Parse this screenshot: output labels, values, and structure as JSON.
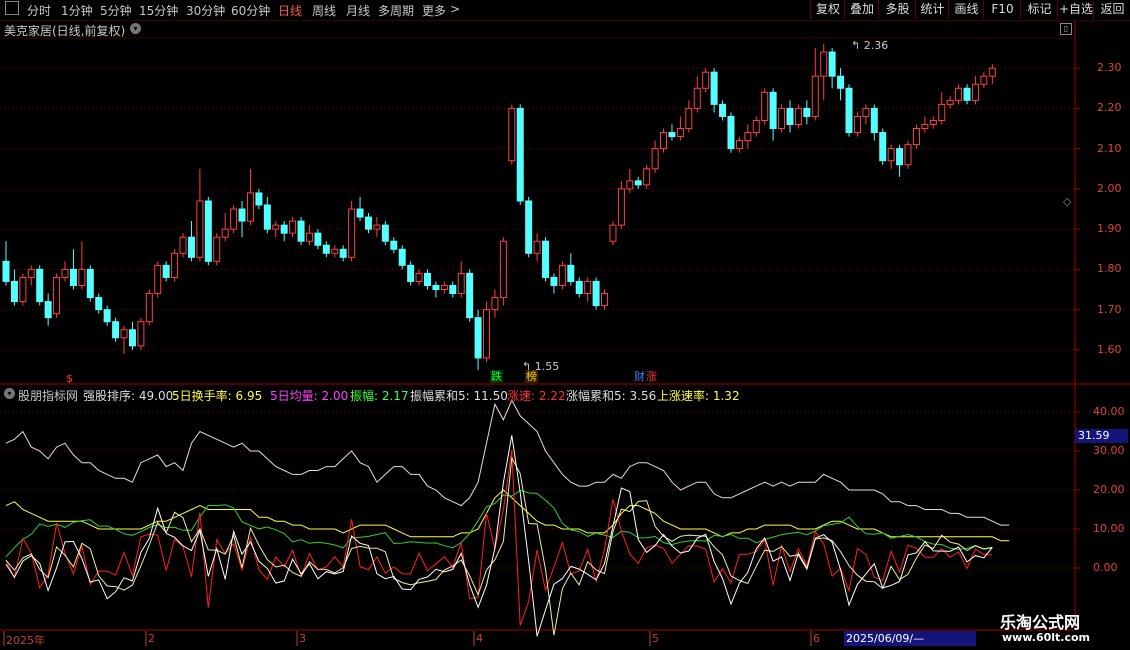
{
  "toolbar": {
    "periods": [
      "分时",
      "1分钟",
      "5分钟",
      "15分钟",
      "30分钟",
      "60分钟",
      "日线",
      "周线",
      "月线",
      "多周期",
      "更多"
    ],
    "active": "日线",
    "more_arrow": ">",
    "buttons": [
      "复权",
      "叠加",
      "多股",
      "统计",
      "画线",
      "F10",
      "标记",
      "+自选",
      "返回"
    ]
  },
  "chart_title": "美克家居(日线,前复权)",
  "price_axis": {
    "labels": [
      "2.30",
      "2.20",
      "2.10",
      "2.00",
      "1.90",
      "1.80",
      "1.70",
      "1.60"
    ],
    "values": [
      2.3,
      2.2,
      2.1,
      2.0,
      1.9,
      1.8,
      1.7,
      1.6
    ]
  },
  "annotations": {
    "high": "2.36",
    "low": "1.55"
  },
  "badges": [
    {
      "text": "$",
      "color": "#ff3030"
    },
    {
      "text": "跌",
      "color": "#00ff40"
    },
    {
      "text": "榜",
      "color": "#ffcc00"
    },
    {
      "text": "财",
      "color": "#4080ff"
    },
    {
      "text": "涨",
      "color": "#ff3030"
    }
  ],
  "indicator": {
    "name": "股朋指标网",
    "items": [
      {
        "label": "强股排序:",
        "value": "49.00",
        "color": "#dddddd"
      },
      {
        "label": "5日换手率:",
        "value": "6.95",
        "color": "#ffff40"
      },
      {
        "label": "5日均量:",
        "value": "2.00",
        "color": "#ff40ff"
      },
      {
        "label": "振幅:",
        "value": "2.17",
        "color": "#40ff40"
      },
      {
        "label": "振幅累和5:",
        "value": "11.50",
        "color": "#dddddd"
      },
      {
        "label": "涨速:",
        "value": "2.22",
        "color": "#ff3030"
      },
      {
        "label": "涨幅累和5:",
        "value": "3.56",
        "color": "#dddddd"
      },
      {
        "label": "上涨速率:",
        "value": "1.32",
        "color": "#ffff40"
      }
    ],
    "axis_labels": [
      "40.00",
      "30.00",
      "20.00",
      "10.00",
      "0.00"
    ],
    "current_value": "31.59"
  },
  "dates": [
    "2025年",
    "2",
    "3",
    "4",
    "5",
    "6"
  ],
  "date_cursor": "2025/06/09/—",
  "watermark": {
    "line1": "乐淘公式网",
    "line2": "www.60lt.com"
  },
  "colors": {
    "up": "#ff4040",
    "down": "#54ffff",
    "grid": "#7a0000",
    "white_line": "#e0e0e0",
    "yellow_line": "#ffff40",
    "green_line": "#30d030",
    "red_line": "#ff2020"
  },
  "chart_data": {
    "type": "candlestick",
    "title": "美克家居(日线,前复权)",
    "ylim": [
      1.55,
      2.36
    ],
    "candles": [
      [
        1.82,
        1.77,
        1.87,
        1.76
      ],
      [
        1.77,
        1.72,
        1.8,
        1.71
      ],
      [
        1.72,
        1.78,
        1.79,
        1.71
      ],
      [
        1.78,
        1.8,
        1.81,
        1.76
      ],
      [
        1.8,
        1.72,
        1.81,
        1.71
      ],
      [
        1.72,
        1.68,
        1.74,
        1.66
      ],
      [
        1.69,
        1.78,
        1.79,
        1.68
      ],
      [
        1.78,
        1.8,
        1.82,
        1.77
      ],
      [
        1.8,
        1.76,
        1.85,
        1.75
      ],
      [
        1.76,
        1.8,
        1.87,
        1.75
      ],
      [
        1.8,
        1.73,
        1.81,
        1.72
      ],
      [
        1.73,
        1.7,
        1.74,
        1.69
      ],
      [
        1.7,
        1.67,
        1.71,
        1.66
      ],
      [
        1.67,
        1.63,
        1.68,
        1.62
      ],
      [
        1.63,
        1.65,
        1.66,
        1.59
      ],
      [
        1.65,
        1.61,
        1.67,
        1.6
      ],
      [
        1.61,
        1.67,
        1.68,
        1.6
      ],
      [
        1.67,
        1.74,
        1.75,
        1.66
      ],
      [
        1.74,
        1.81,
        1.82,
        1.73
      ],
      [
        1.81,
        1.78,
        1.82,
        1.77
      ],
      [
        1.78,
        1.84,
        1.85,
        1.77
      ],
      [
        1.84,
        1.88,
        1.89,
        1.83
      ],
      [
        1.88,
        1.83,
        1.92,
        1.82
      ],
      [
        1.83,
        1.97,
        2.05,
        1.82
      ],
      [
        1.97,
        1.82,
        1.98,
        1.81
      ],
      [
        1.82,
        1.88,
        1.89,
        1.81
      ],
      [
        1.88,
        1.9,
        1.94,
        1.87
      ],
      [
        1.9,
        1.95,
        1.96,
        1.89
      ],
      [
        1.95,
        1.92,
        1.97,
        1.88
      ],
      [
        1.92,
        1.99,
        2.05,
        1.91
      ],
      [
        1.99,
        1.96,
        2.0,
        1.95
      ],
      [
        1.96,
        1.9,
        1.98,
        1.89
      ],
      [
        1.9,
        1.91,
        1.92,
        1.88
      ],
      [
        1.91,
        1.89,
        1.92,
        1.87
      ],
      [
        1.89,
        1.92,
        1.93,
        1.88
      ],
      [
        1.92,
        1.87,
        1.93,
        1.86
      ],
      [
        1.87,
        1.89,
        1.91,
        1.86
      ],
      [
        1.89,
        1.86,
        1.9,
        1.85
      ],
      [
        1.86,
        1.84,
        1.87,
        1.83
      ],
      [
        1.84,
        1.85,
        1.86,
        1.83
      ],
      [
        1.85,
        1.83,
        1.86,
        1.82
      ],
      [
        1.83,
        1.95,
        1.97,
        1.82
      ],
      [
        1.95,
        1.93,
        1.98,
        1.92
      ],
      [
        1.93,
        1.9,
        1.94,
        1.89
      ],
      [
        1.9,
        1.91,
        1.93,
        1.88
      ],
      [
        1.91,
        1.87,
        1.92,
        1.86
      ],
      [
        1.87,
        1.85,
        1.88,
        1.84
      ],
      [
        1.85,
        1.81,
        1.86,
        1.8
      ],
      [
        1.81,
        1.77,
        1.82,
        1.76
      ],
      [
        1.77,
        1.79,
        1.8,
        1.76
      ],
      [
        1.79,
        1.76,
        1.8,
        1.75
      ],
      [
        1.76,
        1.75,
        1.77,
        1.73
      ],
      [
        1.75,
        1.76,
        1.77,
        1.74
      ],
      [
        1.76,
        1.74,
        1.77,
        1.73
      ],
      [
        1.74,
        1.79,
        1.82,
        1.73
      ],
      [
        1.79,
        1.68,
        1.8,
        1.67
      ],
      [
        1.68,
        1.58,
        1.7,
        1.55
      ],
      [
        1.58,
        1.7,
        1.72,
        1.57
      ],
      [
        1.7,
        1.73,
        1.75,
        1.68
      ],
      [
        1.73,
        1.87,
        1.88,
        1.71
      ],
      [
        2.07,
        2.2,
        2.21,
        2.06
      ],
      [
        2.2,
        1.97,
        2.21,
        1.96
      ],
      [
        1.97,
        1.84,
        1.98,
        1.83
      ],
      [
        1.84,
        1.87,
        1.89,
        1.82
      ],
      [
        1.87,
        1.78,
        1.88,
        1.77
      ],
      [
        1.78,
        1.76,
        1.79,
        1.74
      ],
      [
        1.76,
        1.81,
        1.82,
        1.75
      ],
      [
        1.81,
        1.77,
        1.84,
        1.76
      ],
      [
        1.77,
        1.74,
        1.78,
        1.73
      ],
      [
        1.74,
        1.77,
        1.78,
        1.72
      ],
      [
        1.77,
        1.71,
        1.78,
        1.7
      ],
      [
        1.71,
        1.74,
        1.75,
        1.7
      ],
      [
        1.87,
        1.91,
        1.92,
        1.86
      ],
      [
        1.91,
        2.0,
        2.02,
        1.9
      ],
      [
        2.0,
        2.02,
        2.05,
        1.99
      ],
      [
        2.02,
        2.01,
        2.03,
        2.0
      ],
      [
        2.01,
        2.05,
        2.06,
        2.0
      ],
      [
        2.05,
        2.1,
        2.12,
        2.04
      ],
      [
        2.1,
        2.14,
        2.15,
        2.09
      ],
      [
        2.14,
        2.13,
        2.16,
        2.12
      ],
      [
        2.13,
        2.15,
        2.18,
        2.12
      ],
      [
        2.15,
        2.2,
        2.22,
        2.14
      ],
      [
        2.2,
        2.25,
        2.28,
        2.19
      ],
      [
        2.25,
        2.29,
        2.3,
        2.24
      ],
      [
        2.29,
        2.21,
        2.3,
        2.19
      ],
      [
        2.21,
        2.18,
        2.22,
        2.17
      ],
      [
        2.18,
        2.1,
        2.19,
        2.09
      ],
      [
        2.1,
        2.12,
        2.13,
        2.09
      ],
      [
        2.12,
        2.14,
        2.16,
        2.1
      ],
      [
        2.14,
        2.17,
        2.18,
        2.13
      ],
      [
        2.17,
        2.24,
        2.25,
        2.16
      ],
      [
        2.24,
        2.15,
        2.25,
        2.12
      ],
      [
        2.15,
        2.2,
        2.21,
        2.14
      ],
      [
        2.2,
        2.16,
        2.22,
        2.14
      ],
      [
        2.16,
        2.2,
        2.21,
        2.15
      ],
      [
        2.2,
        2.18,
        2.22,
        2.16
      ],
      [
        2.18,
        2.28,
        2.35,
        2.17
      ],
      [
        2.28,
        2.34,
        2.36,
        2.22
      ],
      [
        2.34,
        2.28,
        2.35,
        2.25
      ],
      [
        2.28,
        2.25,
        2.3,
        2.22
      ],
      [
        2.25,
        2.14,
        2.26,
        2.13
      ],
      [
        2.14,
        2.18,
        2.19,
        2.13
      ],
      [
        2.18,
        2.2,
        2.21,
        2.16
      ],
      [
        2.2,
        2.14,
        2.21,
        2.12
      ],
      [
        2.14,
        2.07,
        2.15,
        2.06
      ],
      [
        2.07,
        2.1,
        2.11,
        2.05
      ],
      [
        2.1,
        2.06,
        2.11,
        2.03
      ],
      [
        2.06,
        2.11,
        2.12,
        2.05
      ],
      [
        2.11,
        2.15,
        2.16,
        2.1
      ],
      [
        2.15,
        2.16,
        2.18,
        2.14
      ],
      [
        2.16,
        2.17,
        2.18,
        2.15
      ],
      [
        2.17,
        2.21,
        2.24,
        2.16
      ],
      [
        2.21,
        2.22,
        2.23,
        2.2
      ],
      [
        2.22,
        2.25,
        2.26,
        2.21
      ],
      [
        2.25,
        2.22,
        2.26,
        2.21
      ],
      [
        2.22,
        2.26,
        2.28,
        2.21
      ],
      [
        2.26,
        2.28,
        2.29,
        2.25
      ],
      [
        2.28,
        2.3,
        2.31,
        2.26
      ]
    ],
    "series": [
      {
        "name": "强股排序",
        "values": [
          32,
          33,
          35,
          31,
          30,
          28,
          31,
          32,
          29,
          27,
          27,
          25,
          24,
          23,
          23,
          22,
          27,
          28,
          29,
          26,
          27,
          25,
          32,
          35,
          34,
          33,
          32,
          31,
          32,
          30,
          30,
          28,
          26,
          25,
          24,
          24,
          25,
          25,
          26,
          26,
          28,
          30,
          27,
          26,
          22,
          24,
          26,
          26,
          24,
          24,
          21,
          20,
          18,
          17,
          16,
          18,
          22,
          32,
          42,
          38,
          43,
          39,
          37,
          35,
          30,
          27,
          24,
          22,
          21,
          21,
          22,
          22,
          24,
          23,
          26,
          27,
          27,
          26,
          25,
          22,
          20,
          21,
          22,
          22,
          19,
          18,
          18,
          19,
          20,
          21,
          22,
          21,
          22,
          21,
          22,
          22,
          22,
          24,
          23,
          22,
          20,
          20,
          20,
          20,
          19,
          17,
          17,
          16,
          16,
          15,
          15,
          15,
          14,
          14,
          13,
          13,
          13,
          12,
          11,
          11
        ]
      },
      {
        "name": "5日换手率",
        "values": [
          16,
          17,
          15,
          14,
          13,
          12,
          12,
          12,
          12,
          12,
          11,
          10,
          10,
          10,
          10,
          10,
          10,
          11,
          12,
          12,
          13,
          14,
          15,
          16,
          15,
          15,
          15,
          15,
          15,
          15,
          13,
          13,
          12,
          12,
          11,
          11,
          10,
          10,
          10,
          10,
          9,
          10,
          11,
          11,
          11,
          11,
          10,
          9,
          8,
          8,
          8,
          8,
          8,
          8,
          9,
          9,
          10,
          14,
          18,
          20,
          18,
          16,
          14,
          12,
          11,
          11,
          10,
          10,
          10,
          9,
          9,
          9,
          11,
          14,
          16,
          16,
          15,
          14,
          12,
          11,
          10,
          10,
          10,
          10,
          9,
          8,
          9,
          9,
          10,
          10,
          11,
          11,
          11,
          11,
          10,
          10,
          10,
          11,
          12,
          12,
          11,
          10,
          10,
          10,
          9,
          8,
          8,
          8,
          8,
          8,
          8,
          8,
          8,
          8,
          8,
          8,
          8,
          8,
          7,
          7
        ]
      }
    ]
  }
}
